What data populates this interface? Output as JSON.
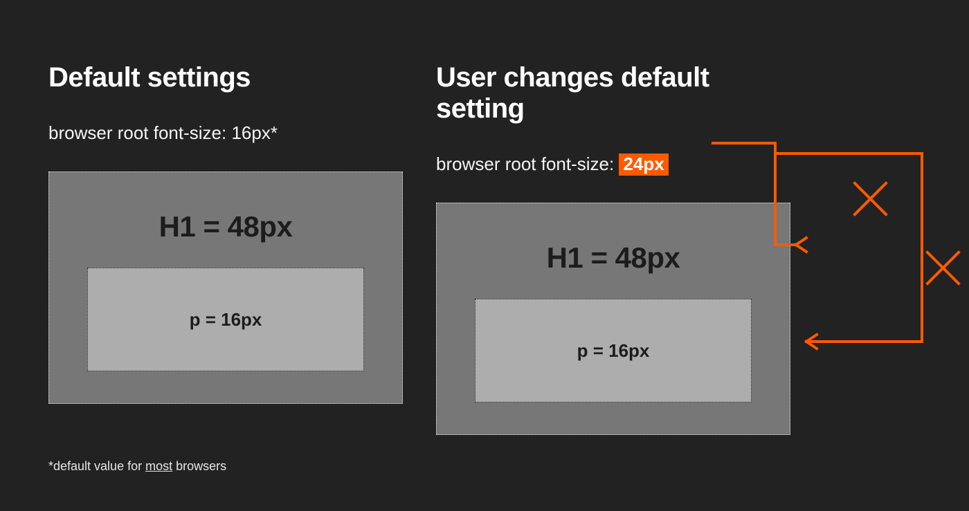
{
  "left": {
    "title": "Default settings",
    "root_line_prefix": "browser root font-size: ",
    "root_value": "16px*",
    "h1_label": "H1 = 48px",
    "p_label": "p = 16px"
  },
  "right": {
    "title": "User changes default setting",
    "root_line_prefix": "browser root font-size: ",
    "root_value": "24px",
    "h1_label": "H1 = 48px",
    "p_label": "p = 16px"
  },
  "footnote": {
    "prefix": "*default value for ",
    "underlined": "most",
    "suffix": " browsers"
  },
  "colors": {
    "bg": "#222222",
    "accent": "#ff5a00",
    "outer_box": "#777777",
    "inner_box": "#adadad"
  }
}
